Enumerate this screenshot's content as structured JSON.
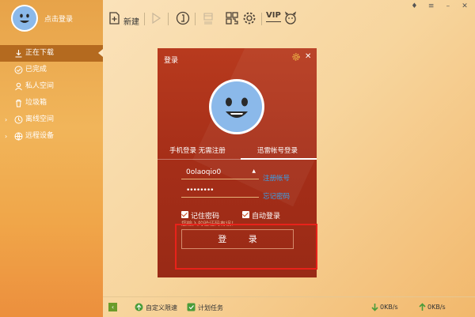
{
  "sidebar": {
    "login_link": "点击登录",
    "items": [
      {
        "label": "正在下载",
        "icon": "download-icon",
        "active": true
      },
      {
        "label": "已完成",
        "icon": "check-circle-icon"
      },
      {
        "label": "私人空间",
        "icon": "user-icon"
      },
      {
        "label": "垃圾箱",
        "icon": "trash-icon"
      },
      {
        "label": "离线空间",
        "icon": "cloud-icon",
        "expandable": true
      },
      {
        "label": "远程设备",
        "icon": "globe-icon",
        "expandable": true
      }
    ]
  },
  "toolbar": {
    "new_label": "新建",
    "buttons": [
      "new-file-icon",
      "play-icon",
      "pause-icon",
      "delete-icon",
      "qr-code-icon",
      "settings-icon",
      "vip-icon",
      "mascot-icon"
    ],
    "vip_text": "VIP"
  },
  "window_controls": [
    "skin-icon",
    "menu-icon",
    "minimize-icon",
    "close-icon"
  ],
  "statusbar": {
    "speed_limit": "自定义限速",
    "scheduled": "计划任务",
    "down_speed": "0KB/s",
    "up_speed": "0KB/s"
  },
  "dialog": {
    "title": "登录",
    "tab_phone": "手机登录 无需注册",
    "tab_account": "迅雷帐号登录",
    "username": "0olaoqio0",
    "password": "••••••••",
    "register_link": "注册帐号",
    "forgot_link": "忘记密码",
    "remember_label": "记住密码",
    "autologin_label": "自动登录",
    "hint": "您输入的验证码有误！",
    "login_button": "登 录"
  },
  "colors": {
    "sidebar_accent": "#b46a1f",
    "dialog_bg": "#a52e18",
    "link": "#3aa0e8",
    "highlight": "#e8221a",
    "avatar_blue": "#8bb9ea"
  }
}
